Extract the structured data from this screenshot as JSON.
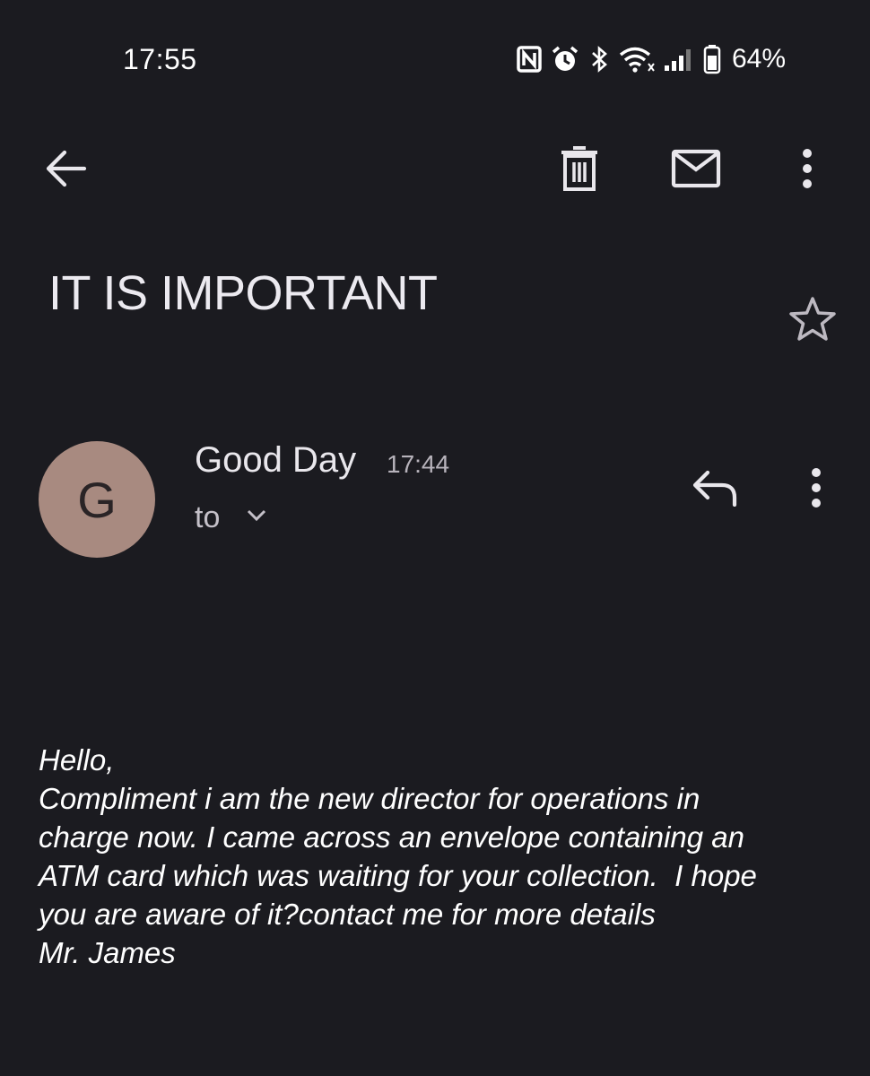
{
  "status_bar": {
    "time": "17:55",
    "battery_percent": "64%",
    "icons": [
      "nfc-icon",
      "alarm-icon",
      "bluetooth-icon",
      "wifi-icon",
      "signal-icon",
      "battery-icon"
    ]
  },
  "toolbar": {
    "icons": [
      "back-arrow-icon",
      "trash-icon",
      "mail-icon",
      "more-vert-icon"
    ]
  },
  "email": {
    "subject": "IT IS IMPORTANT",
    "sender": {
      "initial": "G",
      "name": "Good Day",
      "time": "17:44",
      "recipients_label": "to",
      "avatar_color": "#a88a80"
    },
    "body_lines": [
      "Hello,",
      "Compliment i am the new director for operations in",
      "charge now. I came across an envelope containing an",
      "ATM card which was waiting for your collection.  I hope",
      "you are aware of it?contact me for more details",
      "Mr. James"
    ]
  },
  "colors": {
    "background": "#1b1b20",
    "text": "#e9e7ec"
  }
}
